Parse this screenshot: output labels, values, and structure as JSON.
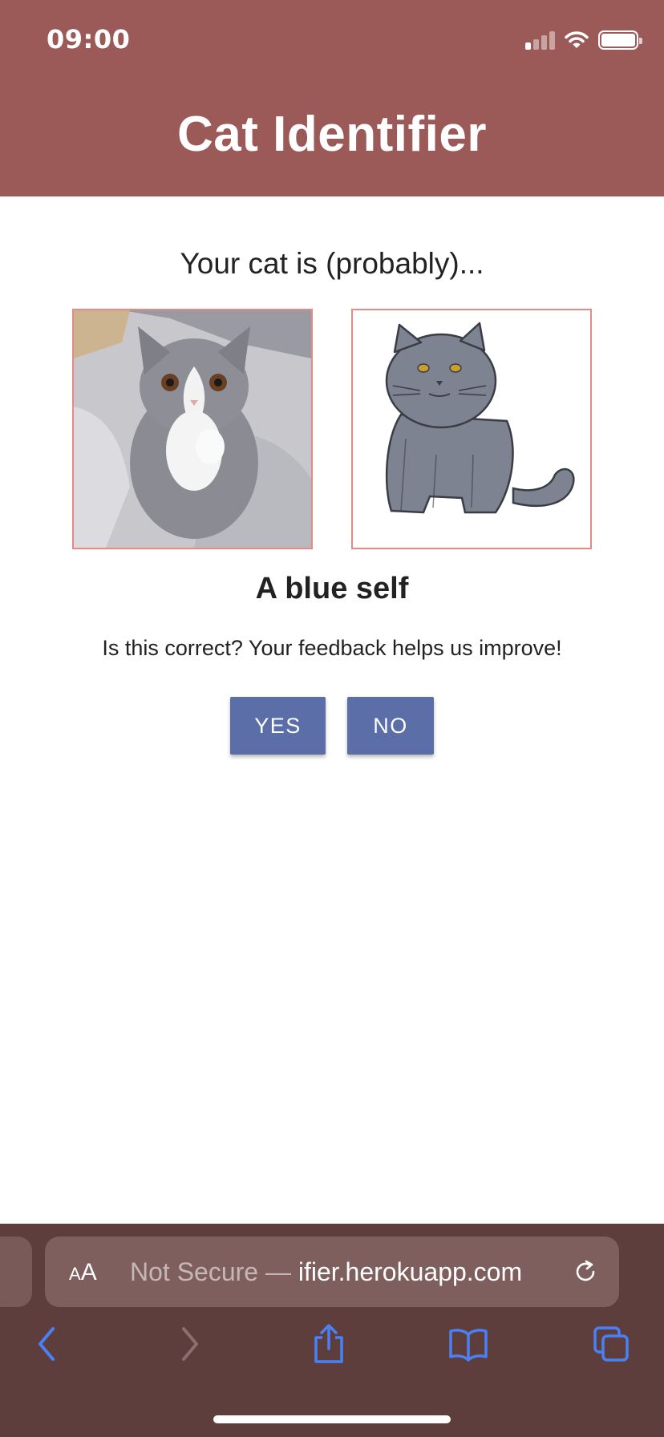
{
  "status_bar": {
    "time": "09:00",
    "icons": [
      "cellular-signal-icon",
      "wifi-icon",
      "battery-icon"
    ]
  },
  "header": {
    "title": "Cat Identifier",
    "background_color": "#9b5a58"
  },
  "main": {
    "subtitle": "Your cat is (probably)...",
    "result": "A blue self",
    "feedback_prompt": "Is this correct? Your feedback helps us improve!",
    "yes_label": "YES",
    "no_label": "NO",
    "button_color": "#5b6ea8",
    "image_border_color": "#e58a85"
  },
  "browser": {
    "aa_small": "A",
    "aa_large": "A",
    "url_prefix": "Not Secure — ",
    "url": "ifier.herokuapp.com",
    "accent_color": "#4a80f5",
    "toolbar_icons": [
      "back-icon",
      "forward-icon",
      "share-icon",
      "bookmarks-icon",
      "tabs-icon"
    ]
  }
}
